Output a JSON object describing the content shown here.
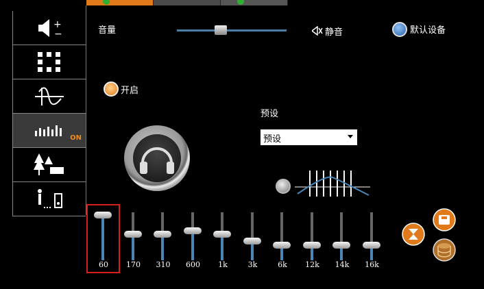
{
  "top_tabs": [
    {
      "name": "tab-1",
      "checked": true
    },
    {
      "name": "tab-2",
      "checked": false
    },
    {
      "name": "tab-3",
      "checked": true
    }
  ],
  "sidebar": {
    "items": [
      {
        "icon": "speaker-volume-icon"
      },
      {
        "icon": "speaker-config-icon"
      },
      {
        "icon": "waveform-icon"
      },
      {
        "icon": "equalizer-icon",
        "status": "ON",
        "active": true
      },
      {
        "icon": "environment-icon"
      },
      {
        "icon": "room-correction-icon"
      }
    ]
  },
  "volume": {
    "label": "音量",
    "level": 0.38
  },
  "mute": {
    "label": "静音"
  },
  "default_device": {
    "label": "默认设备"
  },
  "enable": {
    "label": "开启"
  },
  "preset": {
    "label": "预设",
    "selected": "预设"
  },
  "eq": {
    "bands": [
      {
        "label": "60",
        "level": 0.95,
        "selected": true
      },
      {
        "label": "170",
        "level": 0.55
      },
      {
        "label": "310",
        "level": 0.55
      },
      {
        "label": "600",
        "level": 0.62
      },
      {
        "label": "1k",
        "level": 0.55
      },
      {
        "label": "3k",
        "level": 0.4
      },
      {
        "label": "6k",
        "level": 0.32
      },
      {
        "label": "12k",
        "level": 0.32
      },
      {
        "label": "14k",
        "level": 0.32
      },
      {
        "label": "16k",
        "level": 0.32
      }
    ]
  },
  "colors": {
    "accent": "#e07a1a",
    "slider": "#4a86b8",
    "selection": "#d71e1e"
  }
}
